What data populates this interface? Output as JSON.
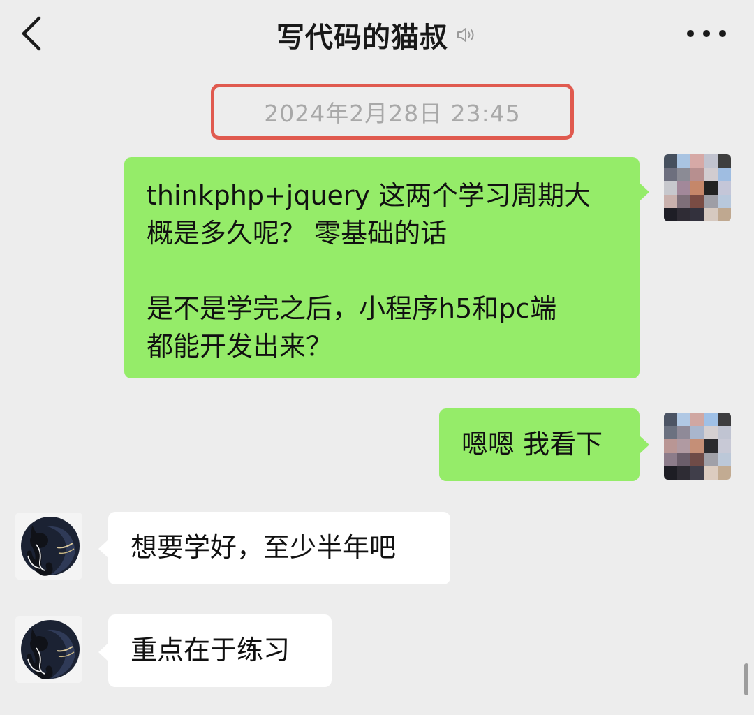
{
  "header": {
    "title": "写代码的猫叔",
    "back_icon": "chevron-left-icon",
    "mute_icon": "speaker-muted-icon",
    "more_icon": "more-dots-icon"
  },
  "timestamp": "2024年2月28日 23:45",
  "messages": [
    {
      "side": "out",
      "text": "thinkphp+jquery 这两个学习周期大\n概是多久呢？ 零基础的话\n\n是不是学完之后，小程序h5和pc端\n都能开发出来？"
    },
    {
      "side": "out",
      "text": "嗯嗯 我看下"
    },
    {
      "side": "in",
      "text": "想要学好，至少半年吧"
    },
    {
      "side": "in",
      "text": "重点在于练习"
    }
  ],
  "colors": {
    "outgoing_bubble": "#95ec69",
    "incoming_bubble": "#ffffff",
    "highlight_border": "#e05a4f",
    "background": "#ededed"
  }
}
